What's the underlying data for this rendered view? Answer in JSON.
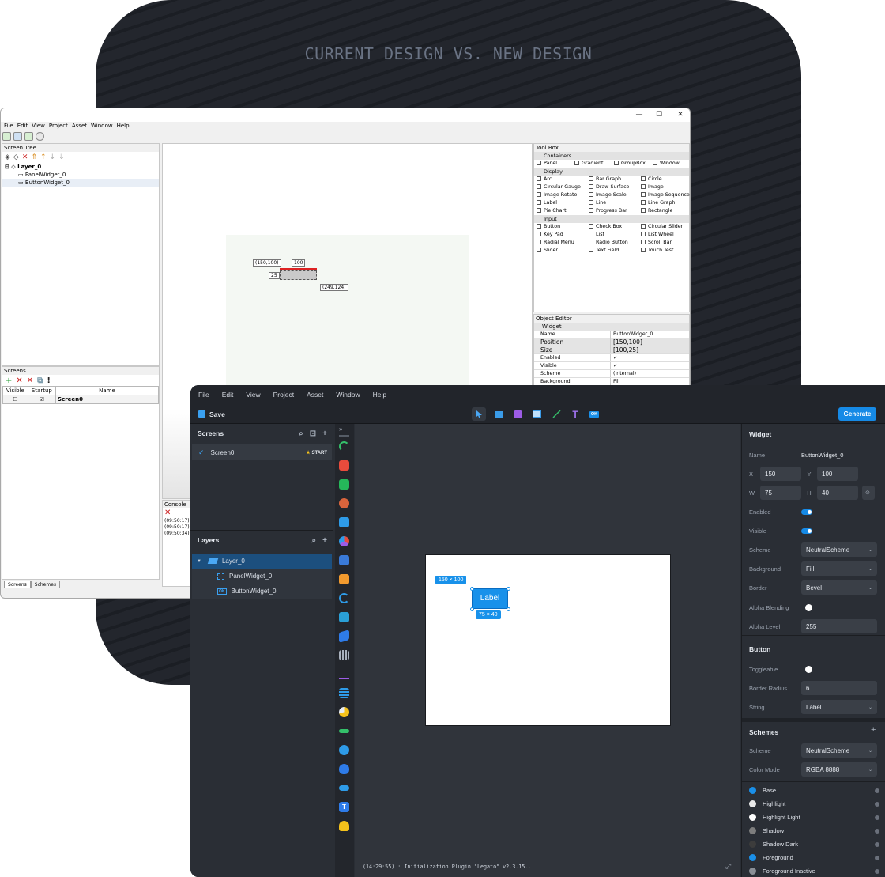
{
  "hero_title": "CURRENT DESIGN VS. NEW DESIGN",
  "old": {
    "menu": [
      "File",
      "Edit",
      "View",
      "Project",
      "Asset",
      "Window",
      "Help"
    ],
    "screen_tree_title": "Screen Tree",
    "tree": [
      "Layer_0",
      "PanelWidget_0",
      "ButtonWidget_0"
    ],
    "screens_title": "Screens",
    "screens_cols": [
      "Visible",
      "Startup",
      "Name"
    ],
    "screen_name": "Screen0",
    "tabs": [
      "Screens",
      "Schemes"
    ],
    "canvas_tags": {
      "pos": "(150,100)",
      "width": "100",
      "height": "25",
      "end": "(249,124)"
    },
    "console_title": "Console",
    "console_lines": [
      "(09:50:17) :",
      "(09:50:17) :",
      "(09:50:34) :"
    ],
    "toolbox_title": "Tool Box",
    "toolbox": {
      "cat_containers": "Containers",
      "containers": [
        "Panel",
        "Gradient",
        "GroupBox",
        "Window"
      ],
      "cat_display": "Display",
      "display": [
        "Arc",
        "Bar Graph",
        "Circle",
        "Circular Gauge",
        "Draw Surface",
        "Image",
        "Image Rotate",
        "Image Scale",
        "Image Sequence",
        "Label",
        "Line",
        "Line Graph",
        "Pie Chart",
        "Progress Bar",
        "Rectangle"
      ],
      "cat_input": "Input",
      "input": [
        "Button",
        "Check Box",
        "Circular Slider",
        "Key Pad",
        "List",
        "List Wheel",
        "Radial Menu",
        "Radio Button",
        "Scroll Bar",
        "Slider",
        "Text Field",
        "Touch Test"
      ]
    },
    "object_editor_title": "Object Editor",
    "oe_header": "Widget",
    "oe_rows": [
      {
        "k": "Name",
        "v": "ButtonWidget_0"
      },
      {
        "k": "Position",
        "v": "[150,100]"
      },
      {
        "k": "Size",
        "v": "[100,25]"
      },
      {
        "k": "Enabled",
        "v": "✓"
      },
      {
        "k": "Visible",
        "v": "✓"
      },
      {
        "k": "Scheme",
        "v": "(internal)"
      },
      {
        "k": "Background",
        "v": "Fill"
      }
    ]
  },
  "new": {
    "menu": [
      "File",
      "Edit",
      "View",
      "Project",
      "Asset",
      "Window",
      "Help"
    ],
    "save": "Save",
    "generate": "Generate",
    "screens_title": "Screens",
    "screen_name": "Screen0",
    "start": "START",
    "layers_title": "Layers",
    "layers": [
      "Layer_0",
      "PanelWidget_0",
      "ButtonWidget_0"
    ],
    "button_label": "Label",
    "pos_tag": "150 × 100",
    "size_tag": "75 × 40",
    "console": "(14:29:55) : Initialization Plugin \"Legato\" v2.3.15...",
    "props": {
      "widget_title": "Widget",
      "name_label": "Name",
      "name_value": "ButtonWidget_0",
      "x_label": "X",
      "x_value": "150",
      "y_label": "Y",
      "y_value": "100",
      "w_label": "W",
      "w_value": "75",
      "h_label": "H",
      "h_value": "40",
      "enabled": "Enabled",
      "visible": "Visible",
      "scheme_label": "Scheme",
      "scheme_value": "NeutralScheme",
      "background_label": "Background",
      "background_value": "Fill",
      "border_label": "Border",
      "border_value": "Bevel",
      "alpha_blending": "Alpha Blending",
      "alpha_level_label": "Alpha Level",
      "alpha_level_value": "255",
      "button_title": "Button",
      "toggleable": "Toggleable",
      "radius_label": "Border Radius",
      "radius_value": "6",
      "string_label": "String",
      "string_value": "Label"
    },
    "schemes": {
      "title": "Schemes",
      "scheme_label": "Scheme",
      "scheme_value": "NeutralScheme",
      "mode_label": "Color Mode",
      "mode_value": "RGBA 8888",
      "colors": [
        {
          "name": "Base",
          "color": "#1a8fe8"
        },
        {
          "name": "Highlight",
          "color": "#e8e8e8"
        },
        {
          "name": "Highlight Light",
          "color": "#ffffff"
        },
        {
          "name": "Shadow",
          "color": "#7d7d7d"
        },
        {
          "name": "Shadow Dark",
          "color": "#3c3c3c"
        },
        {
          "name": "Foreground",
          "color": "#1a8fe8"
        },
        {
          "name": "Foreground Inactive",
          "color": "#8a8f96"
        }
      ]
    }
  }
}
